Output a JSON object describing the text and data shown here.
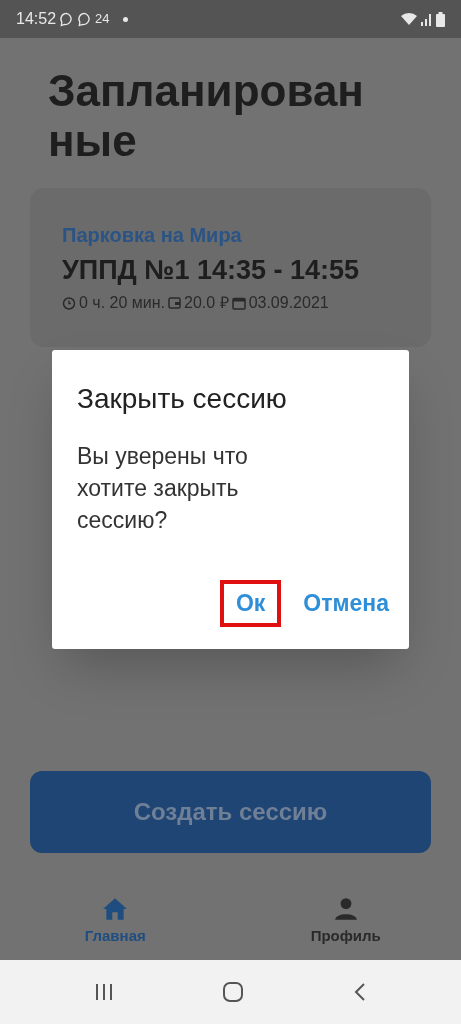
{
  "status_bar": {
    "time": "14:52",
    "notification_text": "24"
  },
  "title": "Запланированные",
  "session_card": {
    "place": "Парковка на Мира",
    "heading": "УППД №1 14:35 - 14:55",
    "duration": "0 ч. 20 мин.",
    "price": "20.0 ₽",
    "date": "03.09.2021"
  },
  "create_button": "Создать сессию",
  "bottom_nav": [
    {
      "label": "Главная",
      "kind": "home",
      "selected": true
    },
    {
      "label": "Профиль",
      "kind": "person",
      "selected": false
    }
  ],
  "dialog": {
    "title": "Закрыть сессию",
    "message": "Вы уверены что хотите закрыть сессию?",
    "buttons": [
      {
        "label": "Ок",
        "highlighted": true
      },
      {
        "label": "Отмена",
        "highlighted": false
      }
    ]
  }
}
